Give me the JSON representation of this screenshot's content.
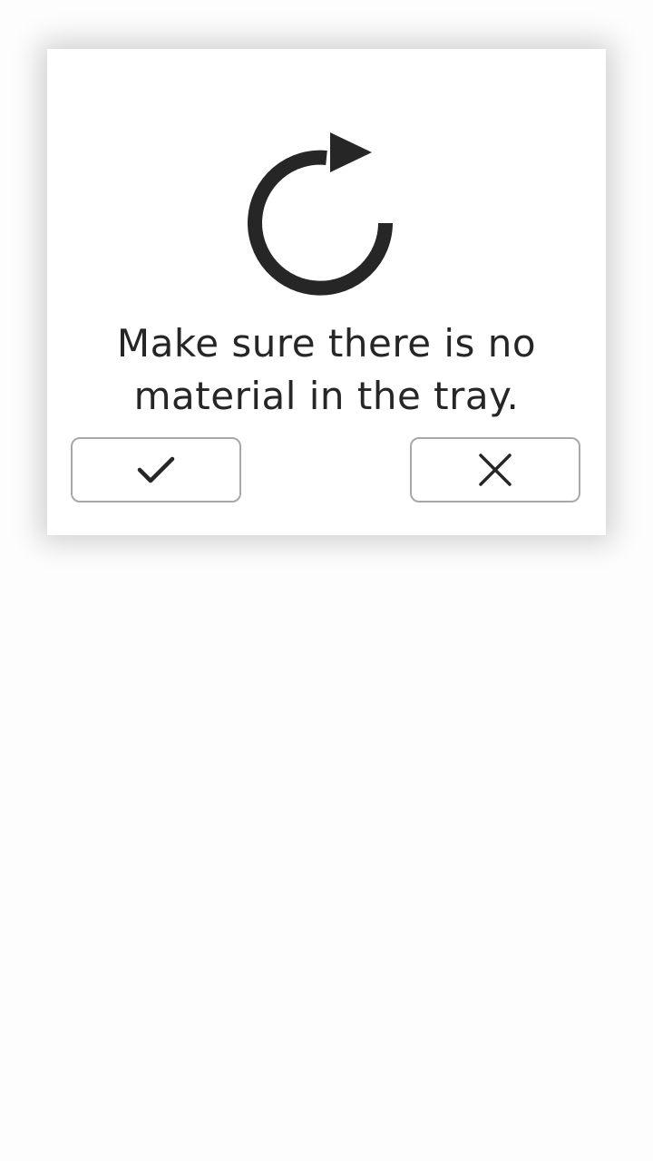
{
  "dialog": {
    "message": "Make sure there is no material in the tray.",
    "icon": "refresh-icon",
    "confirm_icon": "check-icon",
    "cancel_icon": "close-icon"
  },
  "colors": {
    "icon": "#262626",
    "text": "#262626",
    "button_border": "#a8a8a8",
    "background": "#fdfdfd"
  }
}
